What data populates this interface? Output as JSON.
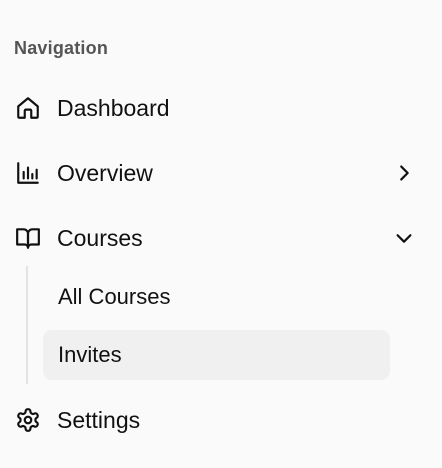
{
  "navigation": {
    "heading": "Navigation",
    "items": {
      "dashboard": {
        "label": "Dashboard",
        "icon": "home-icon"
      },
      "overview": {
        "label": "Overview",
        "icon": "bar-chart-icon",
        "chevron": "chevron-right-icon"
      },
      "courses": {
        "label": "Courses",
        "icon": "book-open-icon",
        "chevron": "chevron-down-icon",
        "expanded": true,
        "children": [
          {
            "label": "All Courses"
          },
          {
            "label": "Invites",
            "active": true
          }
        ]
      },
      "settings": {
        "label": "Settings",
        "icon": "gear-icon"
      }
    }
  }
}
